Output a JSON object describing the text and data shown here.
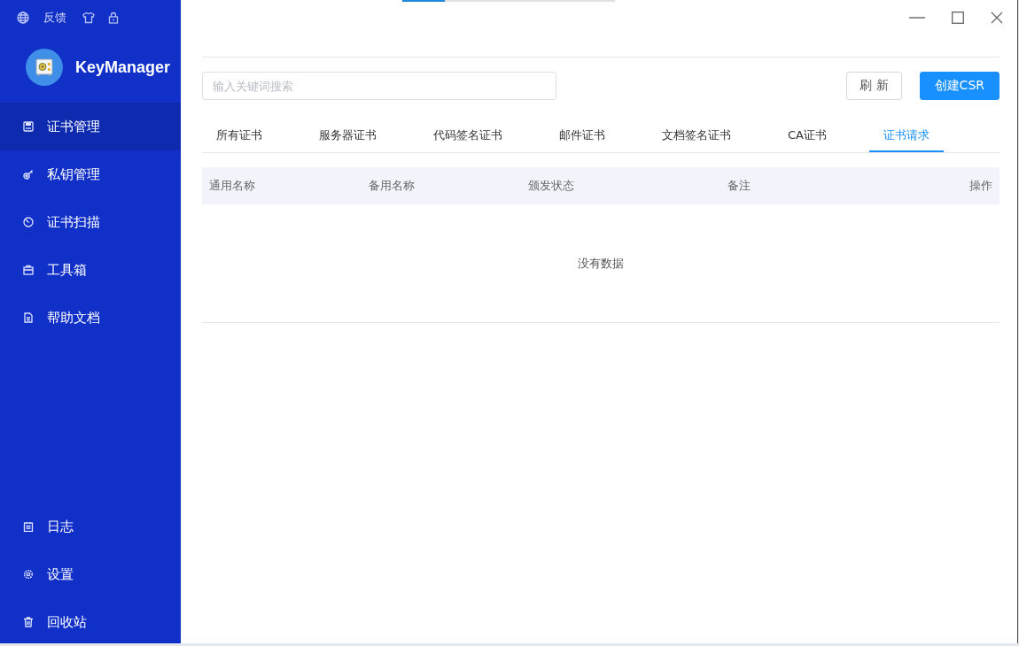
{
  "sidebar": {
    "top_links": [
      {
        "kind": "globe"
      },
      {
        "kind": "text",
        "label": "反馈"
      },
      {
        "kind": "shirt"
      },
      {
        "kind": "lock"
      }
    ],
    "app_name": "KeyManager",
    "items": [
      {
        "label": "证书管理",
        "kind": "disk",
        "selected": true
      },
      {
        "label": "私钥管理",
        "kind": "key",
        "selected": false
      },
      {
        "label": "证书扫描",
        "kind": "scan",
        "selected": false
      },
      {
        "label": "工具箱",
        "kind": "toolbox",
        "selected": false
      },
      {
        "label": "帮助文档",
        "kind": "doc",
        "selected": false
      }
    ],
    "bottom_items": [
      {
        "label": "日志",
        "kind": "log",
        "selected": false
      },
      {
        "label": "设置",
        "kind": "gear",
        "selected": false
      },
      {
        "label": "回收站",
        "kind": "trash",
        "selected": false
      }
    ]
  },
  "loading_bar": {
    "level": 0.2
  },
  "search": {
    "placeholder": "输入关键词搜索"
  },
  "buttons": [
    {
      "label": "刷 新",
      "kind": "default"
    },
    {
      "label": "创建CSR",
      "kind": "primary"
    }
  ],
  "tabs": [
    {
      "label": "所有证书",
      "selected": false
    },
    {
      "label": "服务器证书",
      "selected": false
    },
    {
      "label": "代码签名证书",
      "selected": false
    },
    {
      "label": "邮件证书",
      "selected": false
    },
    {
      "label": "文档签名证书",
      "selected": false
    },
    {
      "label": "CA证书",
      "selected": false
    },
    {
      "label": "证书请求",
      "selected": true
    }
  ],
  "table": {
    "columns": [
      "通用名称",
      "备用名称",
      "颁发状态",
      "备注",
      "操作"
    ],
    "empty_text": "没有数据"
  }
}
